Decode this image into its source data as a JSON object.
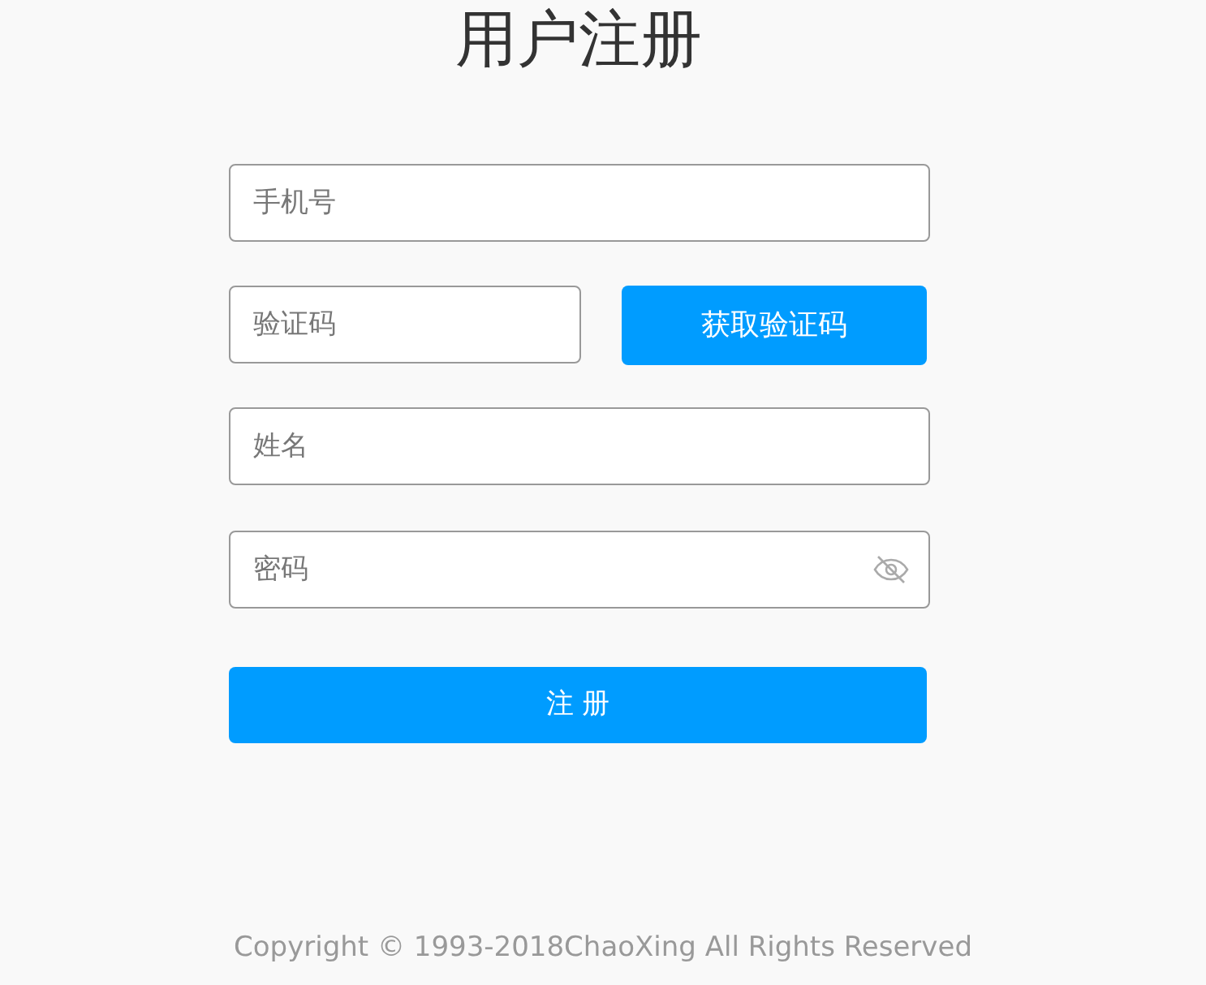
{
  "title": "用户注册",
  "phone_field": {
    "placeholder": "手机号"
  },
  "code_field": {
    "placeholder": "验证码"
  },
  "get_code_button": {
    "label": "获取验证码"
  },
  "name_field": {
    "placeholder": "姓名"
  },
  "password_field": {
    "placeholder": "密码"
  },
  "register_button": {
    "label": "注 册"
  },
  "footer": "Copyright © 1993-2018ChaoXing All Rights Reserved"
}
